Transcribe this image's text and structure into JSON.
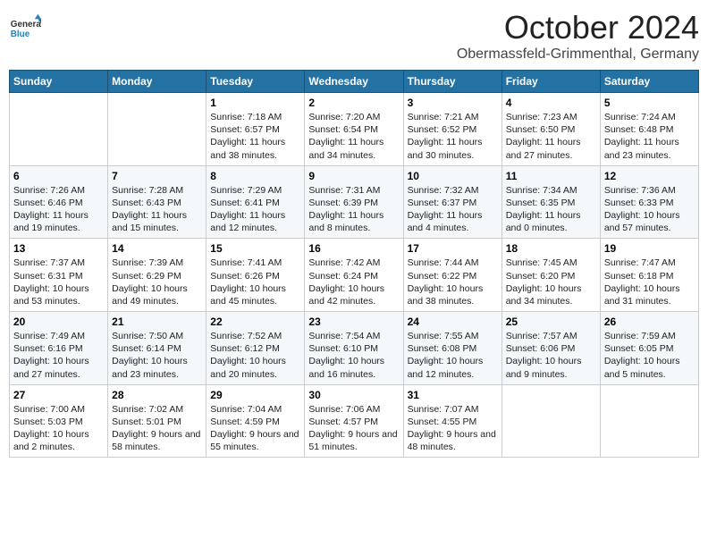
{
  "header": {
    "logo_general": "General",
    "logo_blue": "Blue",
    "month_year": "October 2024",
    "location": "Obermassfeld-Grimmenthal, Germany"
  },
  "weekdays": [
    "Sunday",
    "Monday",
    "Tuesday",
    "Wednesday",
    "Thursday",
    "Friday",
    "Saturday"
  ],
  "weeks": [
    [
      {
        "day": "",
        "sunrise": "",
        "sunset": "",
        "daylight": ""
      },
      {
        "day": "",
        "sunrise": "",
        "sunset": "",
        "daylight": ""
      },
      {
        "day": "1",
        "sunrise": "Sunrise: 7:18 AM",
        "sunset": "Sunset: 6:57 PM",
        "daylight": "Daylight: 11 hours and 38 minutes."
      },
      {
        "day": "2",
        "sunrise": "Sunrise: 7:20 AM",
        "sunset": "Sunset: 6:54 PM",
        "daylight": "Daylight: 11 hours and 34 minutes."
      },
      {
        "day": "3",
        "sunrise": "Sunrise: 7:21 AM",
        "sunset": "Sunset: 6:52 PM",
        "daylight": "Daylight: 11 hours and 30 minutes."
      },
      {
        "day": "4",
        "sunrise": "Sunrise: 7:23 AM",
        "sunset": "Sunset: 6:50 PM",
        "daylight": "Daylight: 11 hours and 27 minutes."
      },
      {
        "day": "5",
        "sunrise": "Sunrise: 7:24 AM",
        "sunset": "Sunset: 6:48 PM",
        "daylight": "Daylight: 11 hours and 23 minutes."
      }
    ],
    [
      {
        "day": "6",
        "sunrise": "Sunrise: 7:26 AM",
        "sunset": "Sunset: 6:46 PM",
        "daylight": "Daylight: 11 hours and 19 minutes."
      },
      {
        "day": "7",
        "sunrise": "Sunrise: 7:28 AM",
        "sunset": "Sunset: 6:43 PM",
        "daylight": "Daylight: 11 hours and 15 minutes."
      },
      {
        "day": "8",
        "sunrise": "Sunrise: 7:29 AM",
        "sunset": "Sunset: 6:41 PM",
        "daylight": "Daylight: 11 hours and 12 minutes."
      },
      {
        "day": "9",
        "sunrise": "Sunrise: 7:31 AM",
        "sunset": "Sunset: 6:39 PM",
        "daylight": "Daylight: 11 hours and 8 minutes."
      },
      {
        "day": "10",
        "sunrise": "Sunrise: 7:32 AM",
        "sunset": "Sunset: 6:37 PM",
        "daylight": "Daylight: 11 hours and 4 minutes."
      },
      {
        "day": "11",
        "sunrise": "Sunrise: 7:34 AM",
        "sunset": "Sunset: 6:35 PM",
        "daylight": "Daylight: 11 hours and 0 minutes."
      },
      {
        "day": "12",
        "sunrise": "Sunrise: 7:36 AM",
        "sunset": "Sunset: 6:33 PM",
        "daylight": "Daylight: 10 hours and 57 minutes."
      }
    ],
    [
      {
        "day": "13",
        "sunrise": "Sunrise: 7:37 AM",
        "sunset": "Sunset: 6:31 PM",
        "daylight": "Daylight: 10 hours and 53 minutes."
      },
      {
        "day": "14",
        "sunrise": "Sunrise: 7:39 AM",
        "sunset": "Sunset: 6:29 PM",
        "daylight": "Daylight: 10 hours and 49 minutes."
      },
      {
        "day": "15",
        "sunrise": "Sunrise: 7:41 AM",
        "sunset": "Sunset: 6:26 PM",
        "daylight": "Daylight: 10 hours and 45 minutes."
      },
      {
        "day": "16",
        "sunrise": "Sunrise: 7:42 AM",
        "sunset": "Sunset: 6:24 PM",
        "daylight": "Daylight: 10 hours and 42 minutes."
      },
      {
        "day": "17",
        "sunrise": "Sunrise: 7:44 AM",
        "sunset": "Sunset: 6:22 PM",
        "daylight": "Daylight: 10 hours and 38 minutes."
      },
      {
        "day": "18",
        "sunrise": "Sunrise: 7:45 AM",
        "sunset": "Sunset: 6:20 PM",
        "daylight": "Daylight: 10 hours and 34 minutes."
      },
      {
        "day": "19",
        "sunrise": "Sunrise: 7:47 AM",
        "sunset": "Sunset: 6:18 PM",
        "daylight": "Daylight: 10 hours and 31 minutes."
      }
    ],
    [
      {
        "day": "20",
        "sunrise": "Sunrise: 7:49 AM",
        "sunset": "Sunset: 6:16 PM",
        "daylight": "Daylight: 10 hours and 27 minutes."
      },
      {
        "day": "21",
        "sunrise": "Sunrise: 7:50 AM",
        "sunset": "Sunset: 6:14 PM",
        "daylight": "Daylight: 10 hours and 23 minutes."
      },
      {
        "day": "22",
        "sunrise": "Sunrise: 7:52 AM",
        "sunset": "Sunset: 6:12 PM",
        "daylight": "Daylight: 10 hours and 20 minutes."
      },
      {
        "day": "23",
        "sunrise": "Sunrise: 7:54 AM",
        "sunset": "Sunset: 6:10 PM",
        "daylight": "Daylight: 10 hours and 16 minutes."
      },
      {
        "day": "24",
        "sunrise": "Sunrise: 7:55 AM",
        "sunset": "Sunset: 6:08 PM",
        "daylight": "Daylight: 10 hours and 12 minutes."
      },
      {
        "day": "25",
        "sunrise": "Sunrise: 7:57 AM",
        "sunset": "Sunset: 6:06 PM",
        "daylight": "Daylight: 10 hours and 9 minutes."
      },
      {
        "day": "26",
        "sunrise": "Sunrise: 7:59 AM",
        "sunset": "Sunset: 6:05 PM",
        "daylight": "Daylight: 10 hours and 5 minutes."
      }
    ],
    [
      {
        "day": "27",
        "sunrise": "Sunrise: 7:00 AM",
        "sunset": "Sunset: 5:03 PM",
        "daylight": "Daylight: 10 hours and 2 minutes."
      },
      {
        "day": "28",
        "sunrise": "Sunrise: 7:02 AM",
        "sunset": "Sunset: 5:01 PM",
        "daylight": "Daylight: 9 hours and 58 minutes."
      },
      {
        "day": "29",
        "sunrise": "Sunrise: 7:04 AM",
        "sunset": "Sunset: 4:59 PM",
        "daylight": "Daylight: 9 hours and 55 minutes."
      },
      {
        "day": "30",
        "sunrise": "Sunrise: 7:06 AM",
        "sunset": "Sunset: 4:57 PM",
        "daylight": "Daylight: 9 hours and 51 minutes."
      },
      {
        "day": "31",
        "sunrise": "Sunrise: 7:07 AM",
        "sunset": "Sunset: 4:55 PM",
        "daylight": "Daylight: 9 hours and 48 minutes."
      },
      {
        "day": "",
        "sunrise": "",
        "sunset": "",
        "daylight": ""
      },
      {
        "day": "",
        "sunrise": "",
        "sunset": "",
        "daylight": ""
      }
    ]
  ]
}
